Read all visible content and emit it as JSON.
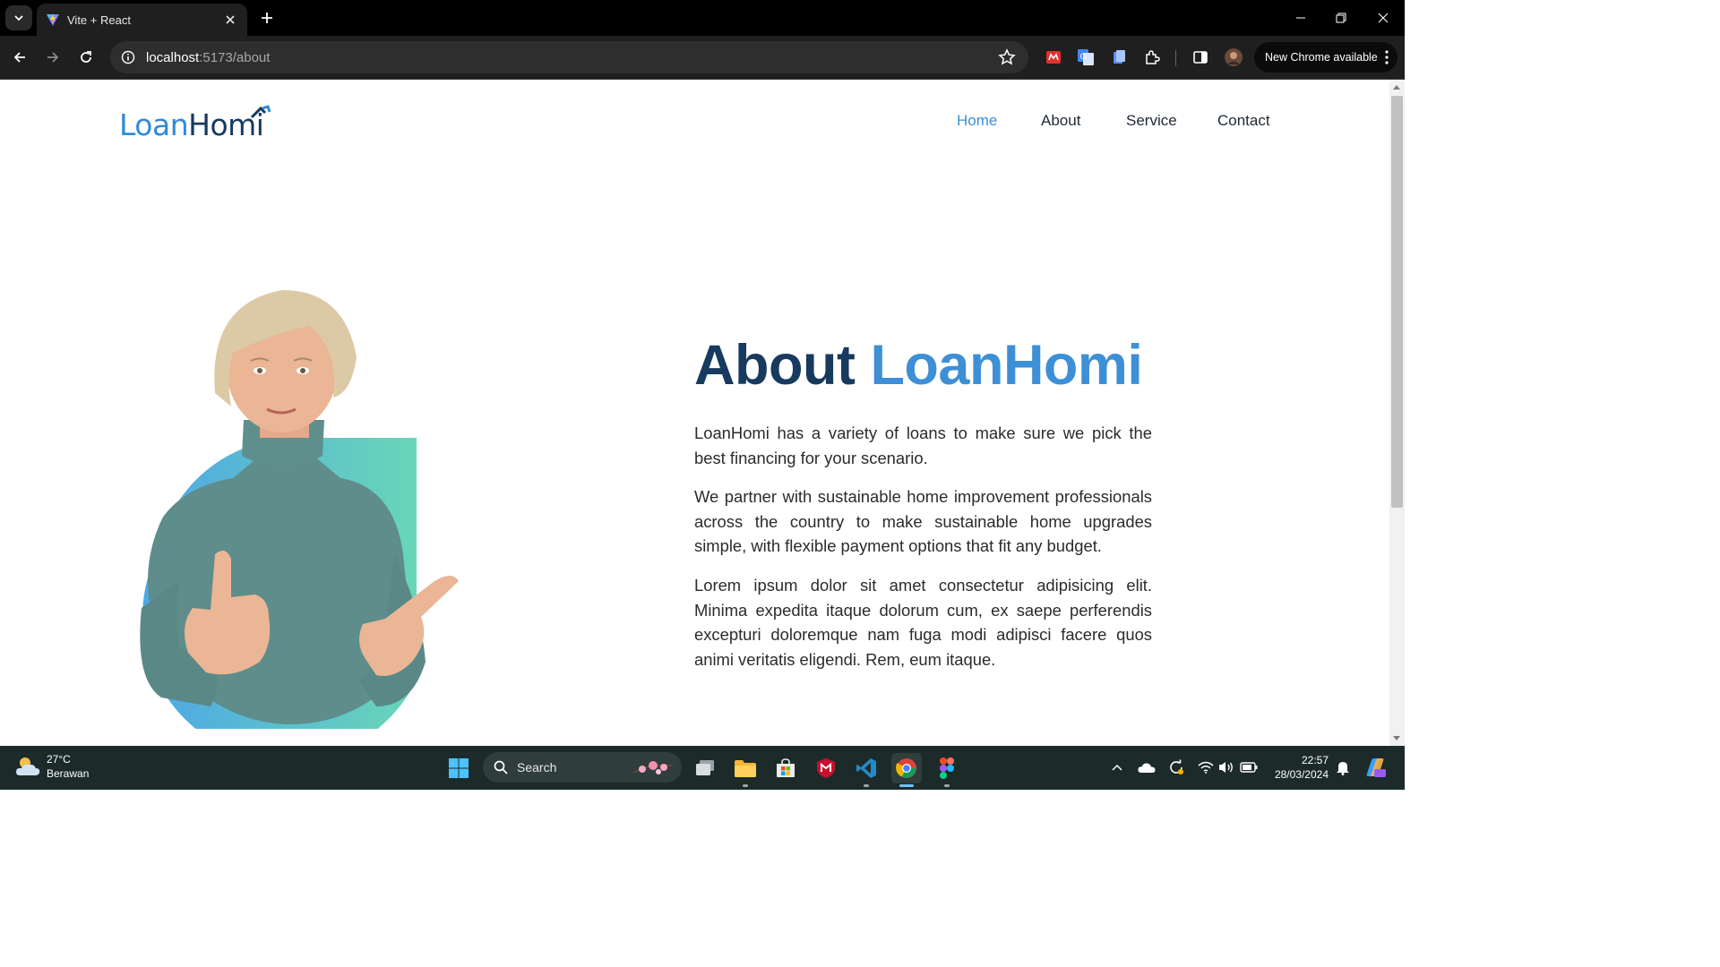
{
  "browser": {
    "tab_title": "Vite + React",
    "url_host": "localhost",
    "url_path": ":5173/about",
    "update_label": "New Chrome available"
  },
  "site": {
    "logo_part1": "Loan",
    "logo_part2": "Homi",
    "nav": [
      {
        "label": "Home",
        "active": true
      },
      {
        "label": "About",
        "active": false
      },
      {
        "label": "Service",
        "active": false
      },
      {
        "label": "Contact",
        "active": false
      }
    ],
    "heading_dark": "About",
    "heading_blue": "LoanHomi",
    "paragraphs": [
      "LoanHomi has a variety of loans to make sure we pick the best financing for your scenario.",
      "We partner with sustainable home improvement professionals across the country to make sustainable home upgrades simple, with flexible payment options that fit any budget.",
      "Lorem ipsum dolor sit amet consectetur adipisicing elit. Minima expedita itaque dolorum cum, ex saepe perferendis excepturi doloremque nam fuga modi adipisci facere quos animi veritatis eligendi. Rem, eum itaque."
    ],
    "colors": {
      "brand_blue": "#3d8fd6",
      "brand_dark": "#173a5e",
      "accent_gradient_start": "#4ea6e6",
      "accent_gradient_end": "#69d6b7"
    }
  },
  "taskbar": {
    "temperature": "27°C",
    "weather_text": "Berawan",
    "search_placeholder": "Search",
    "time": "22:57",
    "date": "28/03/2024"
  }
}
